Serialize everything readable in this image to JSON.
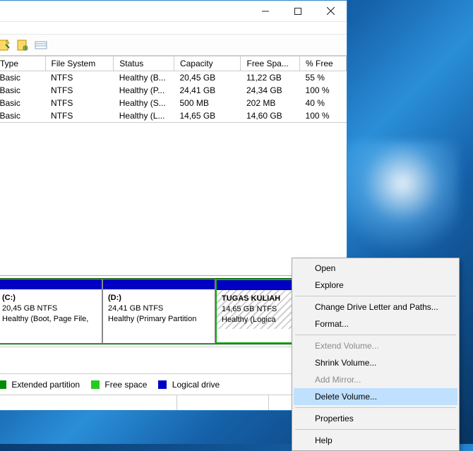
{
  "window": {
    "controls": {
      "minimize": "—",
      "maximize": "▢",
      "close": "✕"
    }
  },
  "table": {
    "headers": [
      "Type",
      "File System",
      "Status",
      "Capacity",
      "Free Spa...",
      "% Free"
    ],
    "rows": [
      {
        "type": "Basic",
        "fs": "NTFS",
        "status": "Healthy (B...",
        "capacity": "20,45 GB",
        "free": "11,22 GB",
        "pct": "55 %"
      },
      {
        "type": "Basic",
        "fs": "NTFS",
        "status": "Healthy (P...",
        "capacity": "24,41 GB",
        "free": "24,34 GB",
        "pct": "100 %"
      },
      {
        "type": "Basic",
        "fs": "NTFS",
        "status": "Healthy (S...",
        "capacity": "500 MB",
        "free": "202 MB",
        "pct": "40 %"
      },
      {
        "type": "Basic",
        "fs": "NTFS",
        "status": "Healthy (L...",
        "capacity": "14,65 GB",
        "free": "14,60 GB",
        "pct": "100 %"
      }
    ]
  },
  "volumes": [
    {
      "title": "(C:)",
      "cap": "20,45 GB NTFS",
      "health": "Healthy (Boot, Page File,"
    },
    {
      "title": "(D:)",
      "cap": "24,41 GB NTFS",
      "health": "Healthy (Primary Partition"
    },
    {
      "title": "TUGAS KULIAH",
      "cap": "14,65 GB NTFS",
      "health": "Healthy (Logica"
    }
  ],
  "legend": {
    "ext": {
      "label": "Extended partition",
      "color": "#008b00"
    },
    "free": {
      "label": "Free space",
      "color": "#22cc22"
    },
    "log": {
      "label": "Logical drive",
      "color": "#0000c4"
    }
  },
  "context_menu": [
    {
      "label": "Open",
      "enabled": true
    },
    {
      "label": "Explore",
      "enabled": true
    },
    {
      "sep": true
    },
    {
      "label": "Change Drive Letter and Paths...",
      "enabled": true
    },
    {
      "label": "Format...",
      "enabled": true
    },
    {
      "sep": true
    },
    {
      "label": "Extend Volume...",
      "enabled": false
    },
    {
      "label": "Shrink Volume...",
      "enabled": true
    },
    {
      "label": "Add Mirror...",
      "enabled": false
    },
    {
      "label": "Delete Volume...",
      "enabled": true,
      "hover": true
    },
    {
      "sep": true
    },
    {
      "label": "Properties",
      "enabled": true
    },
    {
      "sep": true
    },
    {
      "label": "Help",
      "enabled": true
    }
  ]
}
